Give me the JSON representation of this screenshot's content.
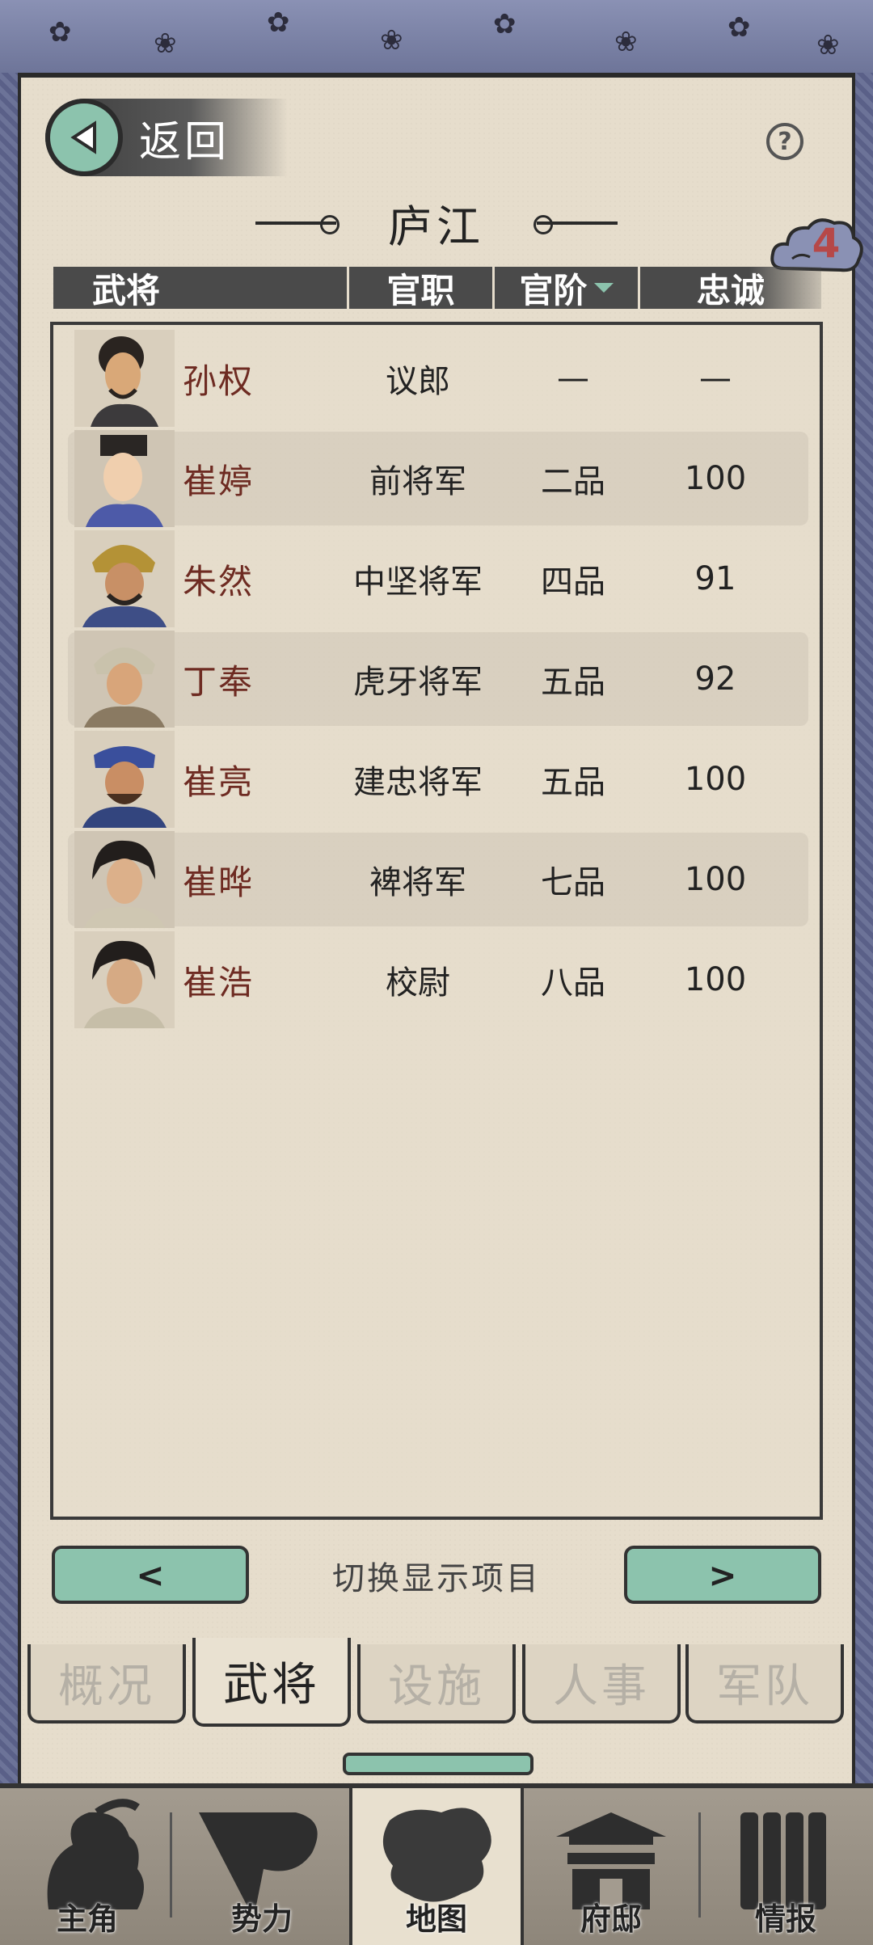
{
  "header": {
    "back_label": "返回",
    "help_label": "?",
    "title": "庐江",
    "badge_count": "4"
  },
  "columns": {
    "general": "武将",
    "office": "官职",
    "rank": "官阶",
    "loyalty": "忠诚"
  },
  "rows": [
    {
      "name": "孙权",
      "office": "议郎",
      "rank": "—",
      "loyalty": "—"
    },
    {
      "name": "崔婷",
      "office": "前将军",
      "rank": "二品",
      "loyalty": "100"
    },
    {
      "name": "朱然",
      "office": "中坚将军",
      "rank": "四品",
      "loyalty": "91"
    },
    {
      "name": "丁奉",
      "office": "虎牙将军",
      "rank": "五品",
      "loyalty": "92"
    },
    {
      "name": "崔亮",
      "office": "建忠将军",
      "rank": "五品",
      "loyalty": "100"
    },
    {
      "name": "崔晔",
      "office": "裨将军",
      "rank": "七品",
      "loyalty": "100"
    },
    {
      "name": "崔浩",
      "office": "校尉",
      "rank": "八品",
      "loyalty": "100"
    }
  ],
  "pager": {
    "prev_label": "<",
    "next_label": ">",
    "switch_label": "切换显示项目"
  },
  "tabs": [
    "概况",
    "武将",
    "设施",
    "人事",
    "军队"
  ],
  "bottom_nav": [
    "主角",
    "势力",
    "地图",
    "府邸",
    "情报"
  ],
  "colors": {
    "accent": "#8cc3ad",
    "paper": "#e6ddcc",
    "name_text": "#6e2b22",
    "badge_text": "#b64848"
  }
}
